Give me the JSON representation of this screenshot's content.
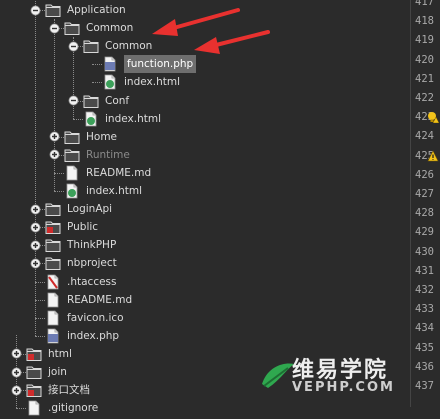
{
  "tree": [
    {
      "label": "Application",
      "level": 2,
      "type": "folder",
      "toggle": "collapse"
    },
    {
      "label": "Common",
      "level": 3,
      "type": "folder",
      "toggle": "collapse"
    },
    {
      "label": "Common",
      "level": 4,
      "type": "folder",
      "toggle": "collapse"
    },
    {
      "label": "function.php",
      "level": 5,
      "type": "php",
      "selected": true
    },
    {
      "label": "index.html",
      "level": 5,
      "type": "html"
    },
    {
      "label": "Conf",
      "level": 4,
      "type": "folder",
      "toggle": "collapse"
    },
    {
      "label": "index.html",
      "level": 4,
      "type": "html"
    },
    {
      "label": "Home",
      "level": 3,
      "type": "folder",
      "toggle": "expand"
    },
    {
      "label": "Runtime",
      "level": 3,
      "type": "folder",
      "toggle": "expand",
      "dim": true
    },
    {
      "label": "README.md",
      "level": 3,
      "type": "file"
    },
    {
      "label": "index.html",
      "level": 3,
      "type": "html"
    },
    {
      "label": "LoginApi",
      "level": 2,
      "type": "folder",
      "toggle": "expand"
    },
    {
      "label": "Public",
      "level": 2,
      "type": "folder",
      "toggle": "expand",
      "badge": true
    },
    {
      "label": "ThinkPHP",
      "level": 2,
      "type": "folder",
      "toggle": "expand"
    },
    {
      "label": "nbproject",
      "level": 2,
      "type": "folder",
      "toggle": "expand"
    },
    {
      "label": ".htaccess",
      "level": 2,
      "type": "htaccess"
    },
    {
      "label": "README.md",
      "level": 2,
      "type": "file"
    },
    {
      "label": "favicon.ico",
      "level": 2,
      "type": "file"
    },
    {
      "label": "index.php",
      "level": 2,
      "type": "php"
    },
    {
      "label": "html",
      "level": 1,
      "type": "folder",
      "toggle": "expand",
      "badge": true
    },
    {
      "label": "join",
      "level": 1,
      "type": "folder",
      "toggle": "expand"
    },
    {
      "label": "接口文档",
      "level": 1,
      "type": "folder",
      "toggle": "expand",
      "badge": true
    },
    {
      "label": ".gitignore",
      "level": 1,
      "type": "file"
    }
  ],
  "gutter": [
    "417",
    "418",
    "419",
    "420",
    "421",
    "422",
    "423",
    "424",
    "425",
    "426",
    "427",
    "428",
    "429",
    "430",
    "431",
    "432",
    "433",
    "434",
    "435",
    "436",
    "437"
  ],
  "gutter_icons": [
    {
      "line_index": 6,
      "name": "lightbulb-warning-icon"
    },
    {
      "line_index": 8,
      "name": "warning-triangle-icon"
    }
  ],
  "annotations": {
    "arrow_color": "#e8312f",
    "arrow_count": 2
  },
  "watermark": {
    "text": "维易学院",
    "sub": "VEPHP.COM"
  },
  "colors": {
    "background": "#2b2b2b",
    "text": "#dcdcdc",
    "selection": "#6e6e6e",
    "arrow": "#e8312f",
    "watermark_green": "#2fa84f"
  }
}
